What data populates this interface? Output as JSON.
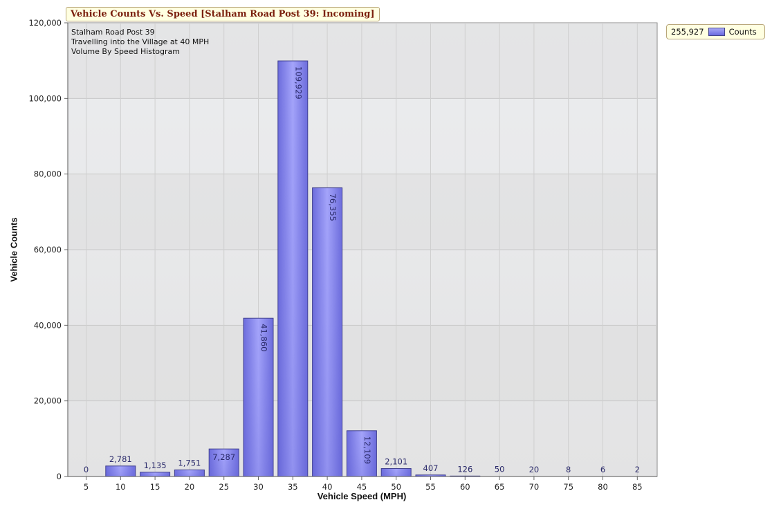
{
  "chart_data": {
    "type": "bar",
    "title": "Vehicle Counts Vs. Speed [Stalham Road Post 39: Incoming]",
    "annotations": [
      "Stalham Road Post 39",
      "Travelling into the Village at 40 MPH",
      "Volume By Speed Histogram"
    ],
    "xlabel": "Vehicle Speed (MPH)",
    "ylabel": "Vehicle Counts",
    "categories": [
      "5",
      "10",
      "15",
      "20",
      "25",
      "30",
      "35",
      "40",
      "45",
      "50",
      "55",
      "60",
      "65",
      "70",
      "75",
      "80",
      "85"
    ],
    "series": [
      {
        "name": "Counts",
        "values": [
          0,
          2781,
          1135,
          1751,
          7287,
          41860,
          109929,
          76355,
          12109,
          2101,
          407,
          126,
          50,
          20,
          8,
          6,
          2
        ],
        "data_labels": [
          "0",
          "2,781",
          "1,135",
          "1,751",
          "7,287",
          "41,860",
          "109,929",
          "76,355",
          "12,109",
          "2,101",
          "407",
          "126",
          "50",
          "20",
          "8",
          "6",
          "2"
        ]
      }
    ],
    "ylim": [
      0,
      120000
    ],
    "yticks": [
      "0",
      "20,000",
      "40,000",
      "60,000",
      "80,000",
      "100,000",
      "120,000"
    ],
    "grid": true,
    "legend": {
      "position": "top-right",
      "total_label": "255,927",
      "series_label": "Counts"
    },
    "colors": {
      "bar_top": "#a8a8f6",
      "bar_mid": "#6b6be0",
      "bar_edge": "#3e3e8e",
      "plot_bg": "#e6e6e6",
      "label_text": "#2b2b6b"
    }
  }
}
